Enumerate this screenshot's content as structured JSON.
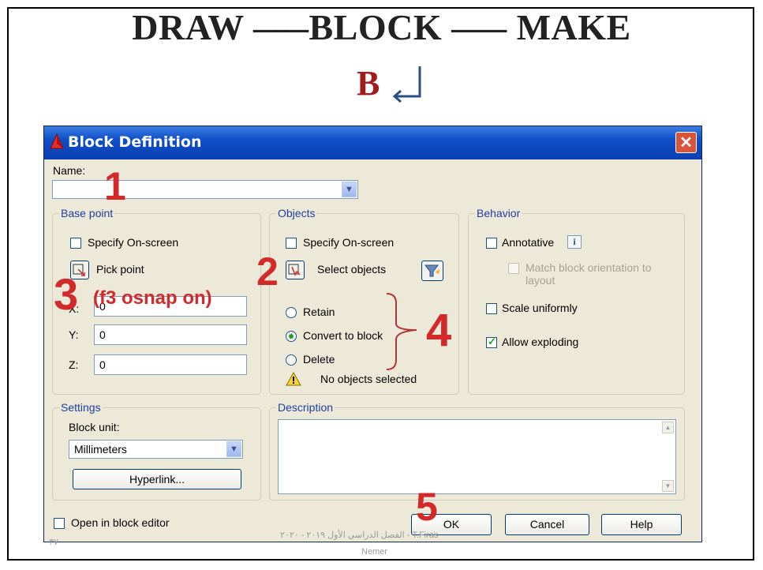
{
  "slide": {
    "title": "DRAW –––BLOCK ––– MAKE",
    "key_letter": "B",
    "footer": "الفصل الدراسي الأول ٢٠١٩ - ٢٠٢٠ - T.Firas",
    "footer_name": "Nemer",
    "page_number": "٣٧"
  },
  "dialog": {
    "title": "Block Definition",
    "name_label": "Name:",
    "name_value": "",
    "base_point": {
      "title": "Base point",
      "specify_on_screen": "Specify On-screen",
      "specify_checked": false,
      "pick_point": "Pick point",
      "x_label": "X:",
      "y_label": "Y:",
      "z_label": "Z:",
      "x_value": "0",
      "y_value": "0",
      "z_value": "0"
    },
    "objects": {
      "title": "Objects",
      "specify_on_screen": "Specify On-screen",
      "select_objects": "Select objects",
      "retain": "Retain",
      "convert": "Convert to block",
      "delete": "Delete",
      "selected_option": "convert",
      "status": "No objects selected"
    },
    "behavior": {
      "title": "Behavior",
      "annotative": "Annotative",
      "match_orientation": "Match block orientation to layout",
      "scale_uniformly": "Scale uniformly",
      "allow_exploding": "Allow exploding",
      "annotative_checked": false,
      "scale_checked": false,
      "allow_checked": true
    },
    "settings": {
      "title": "Settings",
      "block_unit_label": "Block unit:",
      "block_unit_value": "Millimeters",
      "hyperlink_button": "Hyperlink..."
    },
    "description": {
      "title": "Description",
      "value": ""
    },
    "open_in_editor": "Open in block editor",
    "ok_button": "OK",
    "cancel_button": "Cancel",
    "help_button": "Help"
  },
  "annotations": {
    "step1": "1",
    "step2": "2",
    "step3": "3",
    "step3_note": "(f3 osnap on)",
    "step4": "4",
    "step5": "5"
  },
  "colors": {
    "annotation": "#d22a2a",
    "titlebar": "#0f4fc9",
    "key_letter": "#a11b1b",
    "check": "#21a121"
  }
}
